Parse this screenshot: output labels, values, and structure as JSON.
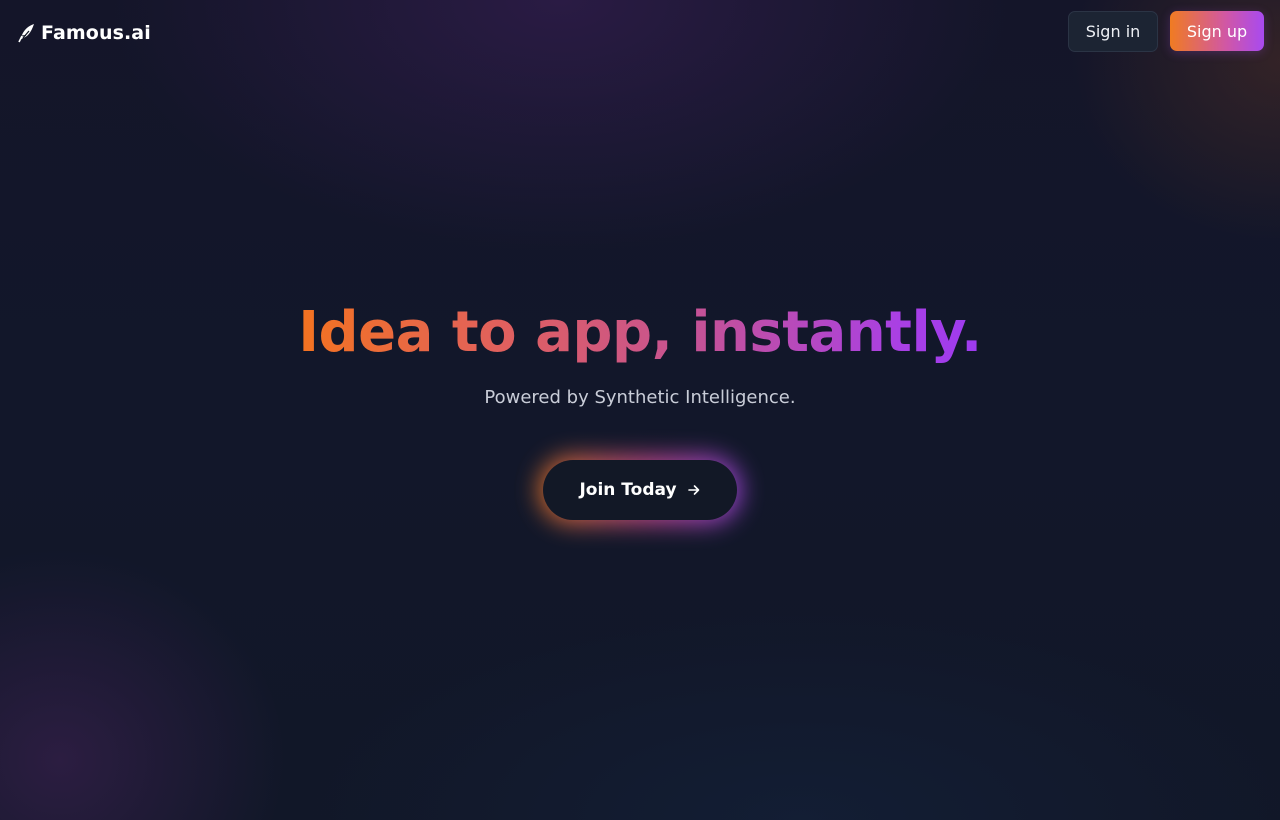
{
  "header": {
    "brand_name": "Famous.ai",
    "brand_icon": "rocket-feather-icon",
    "signin_label": "Sign in",
    "signup_label": "Sign up"
  },
  "hero": {
    "title": "Idea to app, instantly.",
    "subtitle": "Powered by Synthetic Intelligence.",
    "cta_label": "Join Today",
    "cta_icon": "arrow-right-icon"
  },
  "colors": {
    "background": "#111624",
    "accent_orange": "#f07b22",
    "accent_purple": "#a84af0",
    "secondary_button": "#1c2433"
  }
}
